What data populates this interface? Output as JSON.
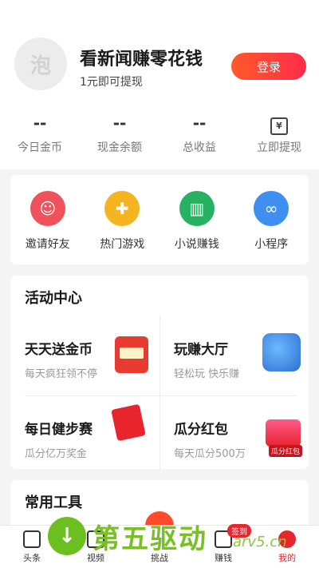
{
  "profile": {
    "avatar_glyph": "泡",
    "headline": "看新闻赚零花钱",
    "subline": "1元即可提现",
    "login_label": "登录"
  },
  "stats": [
    {
      "value": "--",
      "label": "今日金币"
    },
    {
      "value": "--",
      "label": "现金余额"
    },
    {
      "value": "--",
      "label": "总收益"
    },
    {
      "icon": "¥",
      "label": "立即提现"
    }
  ],
  "quick_actions": [
    {
      "label": "邀请好友",
      "color": "#f0525b",
      "icon": "invite-icon"
    },
    {
      "label": "热门游戏",
      "color": "#f5b520",
      "icon": "gamepad-icon"
    },
    {
      "label": "小说赚钱",
      "color": "#27b160",
      "icon": "book-icon"
    },
    {
      "label": "小程序",
      "color": "#3f8ff0",
      "icon": "mini-program-icon"
    }
  ],
  "activity": {
    "title": "活动中心",
    "items": [
      {
        "title": "天天送金币",
        "subtitle": "每天疯狂领不停"
      },
      {
        "title": "玩赚大厅",
        "subtitle": "轻松玩 快乐赚"
      },
      {
        "title": "每日健步赛",
        "subtitle": "瓜分亿万奖金"
      },
      {
        "title": "瓜分红包",
        "subtitle": "每天瓜分500万",
        "tag": "瓜分红包"
      }
    ]
  },
  "tools": {
    "title": "常用工具"
  },
  "tabbar": {
    "tabs": [
      {
        "label": "头条"
      },
      {
        "label": "视频"
      },
      {
        "label": "挑战"
      },
      {
        "label": "赚钱",
        "badge": "签到"
      },
      {
        "label": "我的",
        "active": true
      }
    ]
  },
  "watermark": {
    "text": "第五驱动",
    "url": "arv5.cn"
  }
}
